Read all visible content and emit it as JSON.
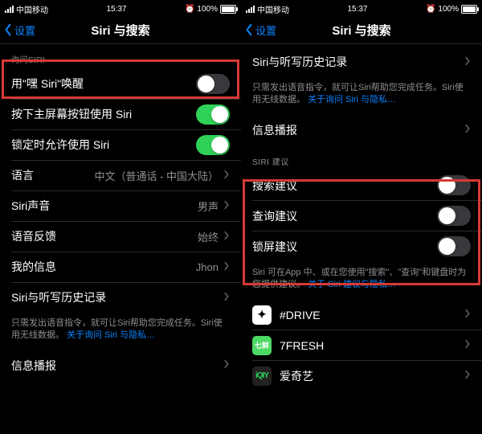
{
  "status": {
    "carrier": "中国移动",
    "time": "15:37",
    "battery_pct": "100%",
    "alarm_icon": "⏰"
  },
  "nav": {
    "back_label": "设置",
    "title": "Siri 与搜索"
  },
  "left": {
    "section_ask_siri": "询问SIRI",
    "rows": {
      "hey_siri": "用\"嘿 Siri\"唤醒",
      "home_button": "按下主屏幕按钮使用 Siri",
      "locked": "锁定时允许使用 Siri",
      "language": {
        "label": "语言",
        "value": "中文（普通话 - 中国大陆）"
      },
      "voice": {
        "label": "Siri声音",
        "value": "男声"
      },
      "feedback": {
        "label": "语音反馈",
        "value": "始终"
      },
      "myinfo": {
        "label": "我的信息",
        "value": "Jhon"
      },
      "history": "Siri与听写历史记录"
    },
    "footer1": {
      "text": "只需发出语音指令，就可让Siri帮助您完成任务。Siri使用无线数据。",
      "link": "关于询问 Siri 与隐私…"
    },
    "announce": "信息播报"
  },
  "right": {
    "history": "Siri与听写历史记录",
    "footer1": {
      "text": "只需发出语音指令，就可让Siri帮助您完成任务。Siri使用无线数据。",
      "link": "关于询问 Siri 与隐私…"
    },
    "announce": "信息播报",
    "section_suggest": "SIRI 建议",
    "rows": {
      "search": "搜索建议",
      "lookup": "查询建议",
      "lock": "锁屏建议"
    },
    "footer2": {
      "text": "Siri 可在App 中、或在您使用\"搜索\"、\"查询\"和键盘时为您提供建议。",
      "link": "关于 Siri 建议与隐私…"
    },
    "apps": {
      "drive": "#DRIVE",
      "sevenfresh": "7FRESH",
      "iqiyi": "爱奇艺"
    }
  }
}
